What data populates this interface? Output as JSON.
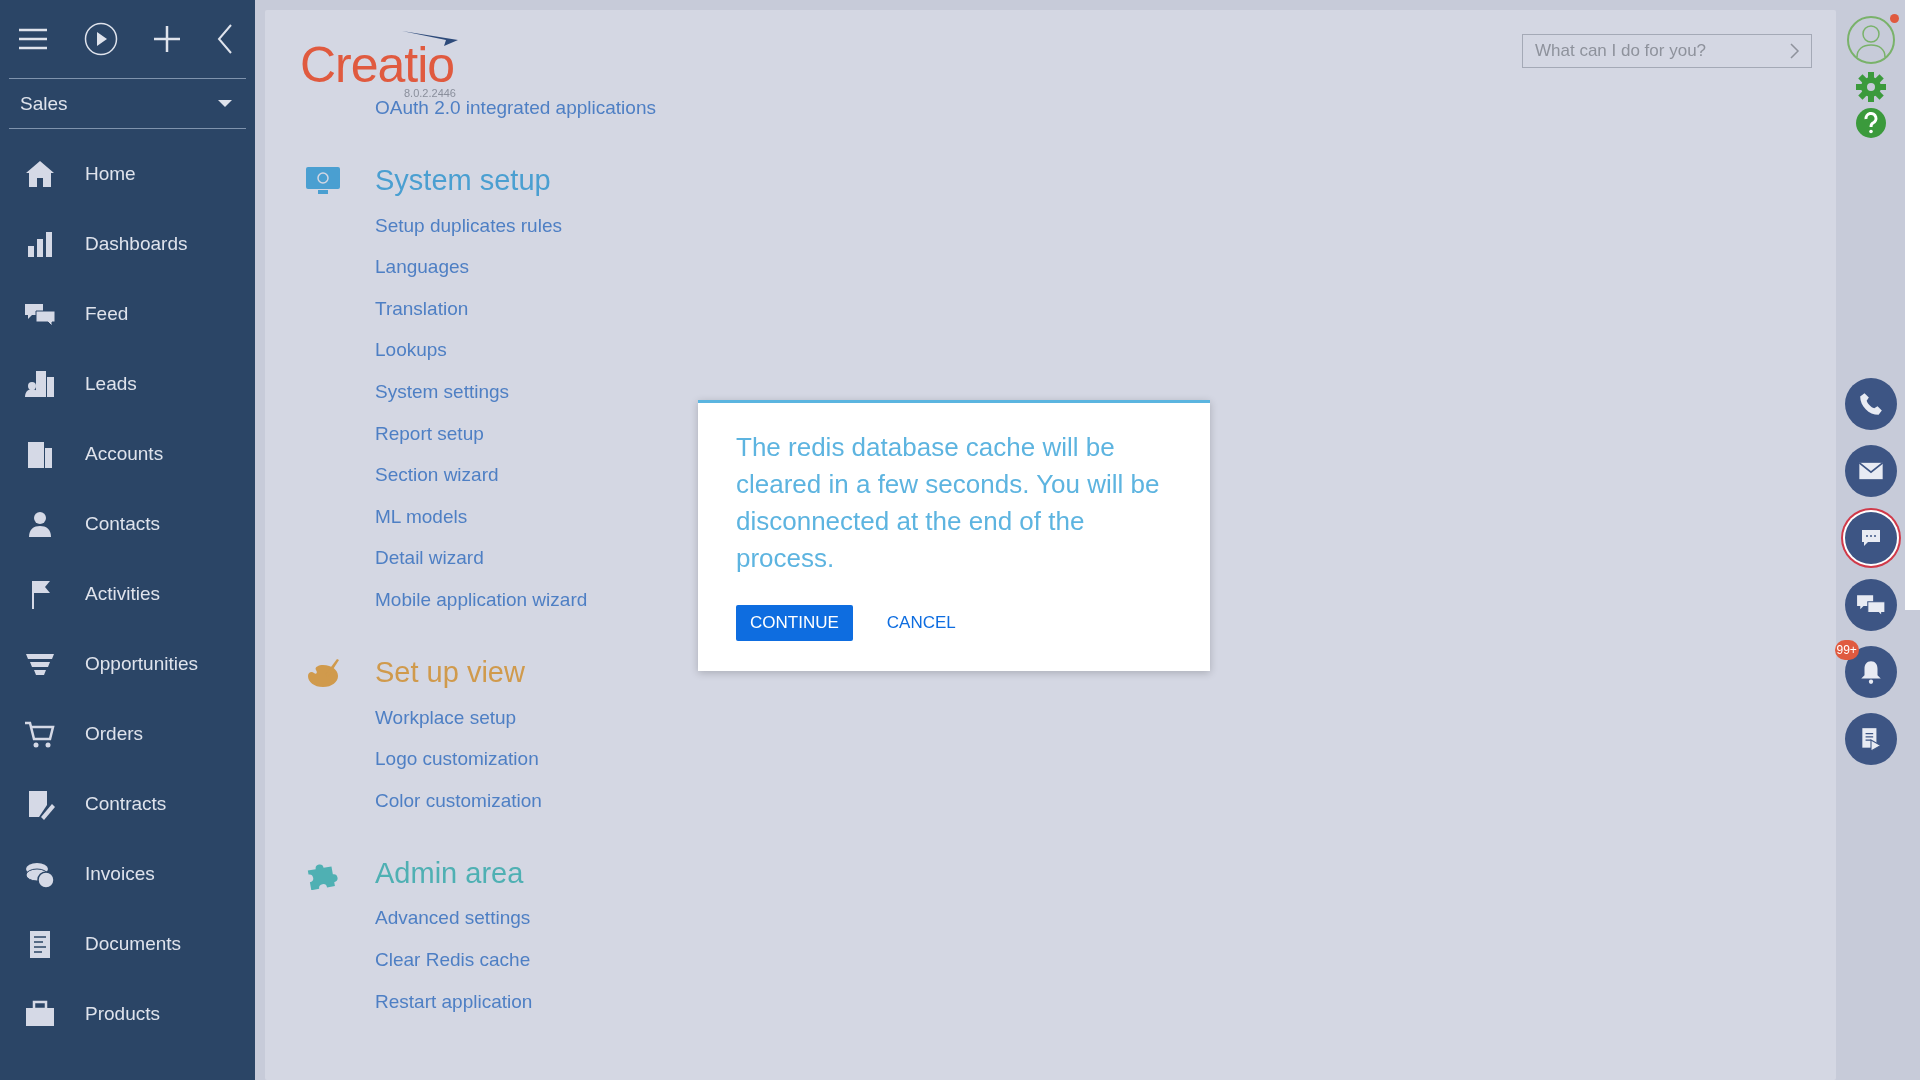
{
  "sidebar": {
    "workplace": "Sales",
    "items": [
      {
        "label": "Home",
        "kind": "home"
      },
      {
        "label": "Dashboards",
        "kind": "chart"
      },
      {
        "label": "Feed",
        "kind": "feed"
      },
      {
        "label": "Leads",
        "kind": "leads"
      },
      {
        "label": "Accounts",
        "kind": "building"
      },
      {
        "label": "Contacts",
        "kind": "person"
      },
      {
        "label": "Activities",
        "kind": "flag"
      },
      {
        "label": "Opportunities",
        "kind": "funnel"
      },
      {
        "label": "Orders",
        "kind": "cart"
      },
      {
        "label": "Contracts",
        "kind": "contract"
      },
      {
        "label": "Invoices",
        "kind": "coins"
      },
      {
        "label": "Documents",
        "kind": "document"
      },
      {
        "label": "Products",
        "kind": "products"
      }
    ]
  },
  "header": {
    "logo": "Creatio",
    "version": "8.0.2.2446",
    "search": {
      "placeholder": "What can I do for you?"
    }
  },
  "links_above": [
    "OAuth 2.0 integrated applications"
  ],
  "sections": [
    {
      "title": "System setup",
      "kind": "monitor",
      "color": "#4a9fd1",
      "links": [
        "Setup duplicates rules",
        "Languages",
        "Translation",
        "Lookups",
        "System settings",
        "Report setup",
        "Section wizard",
        "ML models",
        "Detail wizard",
        "Mobile application wizard"
      ]
    },
    {
      "title": "Set up view",
      "kind": "palette",
      "color": "#d09a4c",
      "links": [
        "Workplace setup",
        "Logo customization",
        "Color customization"
      ]
    },
    {
      "title": "Admin area",
      "kind": "puzzle",
      "color": "#4fb0b3",
      "links": [
        "Advanced settings",
        "Clear Redis cache",
        "Restart application"
      ]
    }
  ],
  "rail": [
    {
      "kind": "phone",
      "selected": false
    },
    {
      "kind": "email",
      "selected": false
    },
    {
      "kind": "chat",
      "selected": true
    },
    {
      "kind": "messages",
      "selected": false
    },
    {
      "kind": "bell",
      "selected": false,
      "badge": "99+"
    },
    {
      "kind": "process",
      "selected": false
    }
  ],
  "dialog": {
    "message": "The redis database cache will be cleared in a few seconds. You will be disconnected at the end of the process.",
    "buttons": [
      {
        "label": "CONTINUE",
        "kind": "primary"
      },
      {
        "label": "CANCEL",
        "kind": "link"
      }
    ]
  }
}
